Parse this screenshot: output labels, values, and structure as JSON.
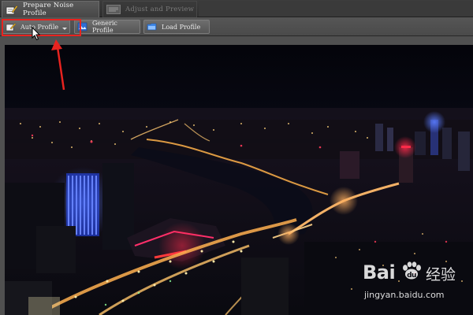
{
  "tabs": [
    {
      "label": "Prepare Noise Profile",
      "active": true
    },
    {
      "label": "Adjust and Preview",
      "active": false
    }
  ],
  "toolbar": {
    "auto_profile_label": "Auto Profile",
    "generic_profile_label": "Generic Profile",
    "load_profile_label": "Load Profile"
  },
  "annotation": {
    "color": "#e8231f"
  },
  "watermark": {
    "logo": "Bai 经验",
    "brand_latin": "Bai",
    "brand_cn": "经验",
    "url": "jingyan.baidu.com"
  },
  "icons": {
    "tab1": "notebook-pencil-icon",
    "tab2": "waveform-icon",
    "auto": "wand-icon",
    "generic": "picture-icon",
    "load": "folder-icon"
  }
}
